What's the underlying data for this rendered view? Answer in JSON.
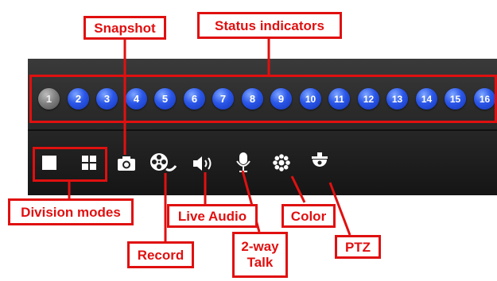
{
  "channels": {
    "items": [
      "1",
      "2",
      "3",
      "4",
      "5",
      "6",
      "7",
      "8",
      "9",
      "10",
      "11",
      "12",
      "13",
      "14",
      "15",
      "16"
    ],
    "inactive_index": 0,
    "active_color": "#2a56e8",
    "inactive_color": "#7c7c7c"
  },
  "toolbar": {
    "icons": [
      "single-view-icon",
      "quad-view-icon",
      "camera-icon",
      "film-reel-icon",
      "speaker-icon",
      "microphone-icon",
      "color-settings-icon",
      "ptz-camera-icon"
    ]
  },
  "callouts": {
    "snapshot": "Snapshot",
    "status_indicators": "Status indicators",
    "division_modes": "Division modes",
    "live_audio": "Live Audio",
    "color": "Color",
    "record": "Record",
    "two_way_talk_line1": "2-way",
    "two_way_talk_line2": "Talk",
    "ptz": "PTZ"
  },
  "accent_color": "#e01010"
}
